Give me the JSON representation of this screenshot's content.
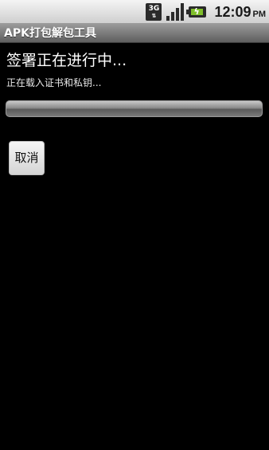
{
  "status_bar": {
    "network_label": "3G",
    "network_arrows": "⇅",
    "time": "12:09",
    "ampm": "PM"
  },
  "app": {
    "title": "APK打包解包工具"
  },
  "dialog": {
    "heading": "签署正在进行中...",
    "message": "正在载入证书和私钥...",
    "progress_fraction": 0,
    "cancel_label": "取消"
  },
  "colors": {
    "background": "#000000",
    "battery_fill": "#7fbf2a"
  },
  "icons": [
    "network-3g-icon",
    "signal-strength-icon",
    "battery-charging-icon"
  ]
}
